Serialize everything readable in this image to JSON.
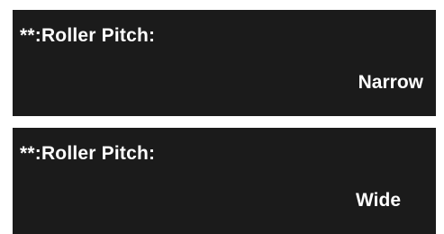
{
  "screens": [
    {
      "title": "**:Roller Pitch:",
      "value": "Narrow"
    },
    {
      "title": "**:Roller Pitch:",
      "value": "Wide"
    }
  ],
  "colors": {
    "panel_background": "#1b1b1b",
    "text": "#ffffff",
    "page_background": "#ffffff"
  }
}
